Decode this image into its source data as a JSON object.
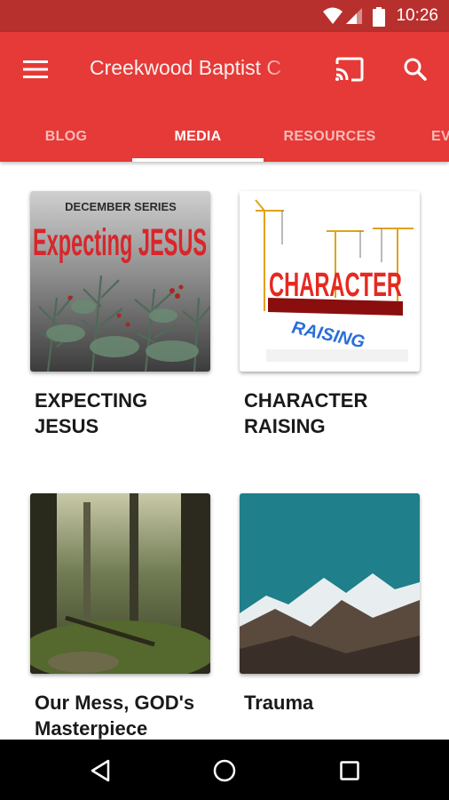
{
  "status_bar": {
    "time": "10:26",
    "icons": [
      "wifi-icon",
      "signal-icon",
      "battery-icon"
    ]
  },
  "app_bar": {
    "title": "Creekwood Baptist C",
    "menu_icon": "menu-icon",
    "cast_icon": "cast-icon",
    "search_icon": "search-icon",
    "background": "#e53a37"
  },
  "tabs": [
    {
      "label": "BLOG",
      "active": false
    },
    {
      "label": "MEDIA",
      "active": true
    },
    {
      "label": "RESOURCES",
      "active": false
    },
    {
      "label": "EV",
      "active": false
    }
  ],
  "media": [
    {
      "title": "EXPECTING JESUS",
      "thumb_overline": "DECEMBER SERIES",
      "thumb_text": "Expecting JESUS"
    },
    {
      "title": "CHARACTER RAISING",
      "thumb_text": "CHARACTER",
      "thumb_subtext": "RAISING"
    },
    {
      "title": "Our Mess, GOD's Masterpiece"
    },
    {
      "title": "Trauma"
    }
  ],
  "nav_bar": {
    "icons": [
      "back-icon",
      "home-icon",
      "recents-icon"
    ]
  }
}
